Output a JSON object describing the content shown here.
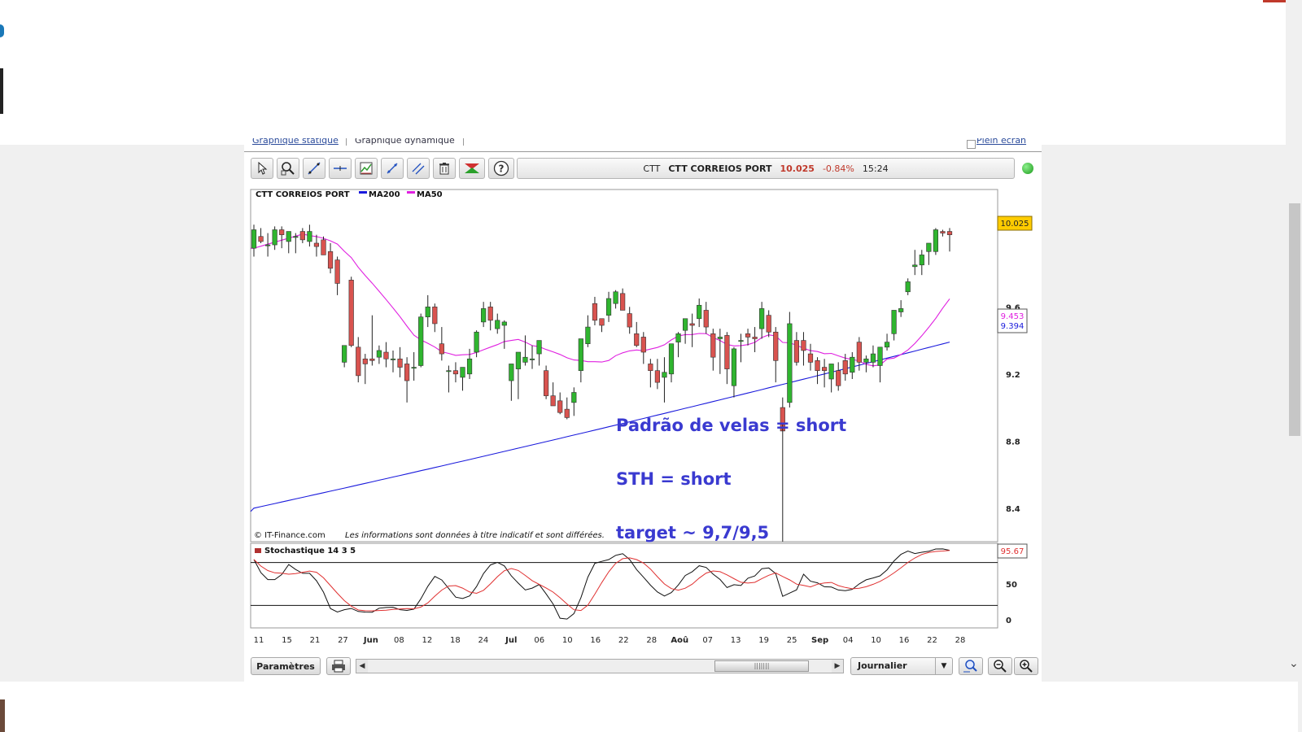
{
  "tabs": [
    "Graphique statique",
    "Graphique dynamique",
    "Plein écran"
  ],
  "toolbar": {
    "tools": [
      "cursor-icon",
      "zoom-area-icon",
      "trendline-icon",
      "horizontal-line-icon",
      "indicators-icon",
      "fibonacci-icon",
      "channel-icon",
      "trash-icon",
      "signal-icon",
      "help-icon"
    ]
  },
  "quote": {
    "ticker": "CTT",
    "name": "CTT CORREIOS PORT",
    "price": "10.025",
    "change": "-0.84%",
    "time": "15:24"
  },
  "colors": {
    "up": "#2fb52f",
    "down": "#d9534f",
    "ma200": "#1a1adc",
    "ma50": "#e020e0",
    "stoch_k": "#111111",
    "stoch_d": "#e03030",
    "annotation": "#3a3ad0"
  },
  "legend": {
    "series": "CTT CORREIOS PORT",
    "ma200": "MA200",
    "ma50": "MA50"
  },
  "copyright": "© IT-Finance.com",
  "disclaimer": "Les informations sont données à titre indicatif et sont différées.",
  "annotations": [
    "Padrão de velas = short",
    "STH = short",
    "target ~ 9,7/9,5"
  ],
  "price_labels": {
    "last": "10.025",
    "ma50": "9.453",
    "ma200": "9.394",
    "stoch_last": "95.67"
  },
  "stoch_legend": "Stochastique 14 3 5",
  "bottom": {
    "params": "Paramètres",
    "period": "Journalier"
  },
  "chart_data": {
    "type": "candlestick",
    "title": "CTT CORREIOS PORT",
    "y_ticks": [
      "9.6",
      "9.2",
      "8.8",
      "8.4"
    ],
    "ylim": [
      8.2,
      10.3
    ],
    "x_ticks": [
      "11",
      "15",
      "21",
      "27",
      "Jun",
      "08",
      "12",
      "18",
      "24",
      "Jul",
      "06",
      "10",
      "16",
      "22",
      "28",
      "Aoû",
      "07",
      "13",
      "19",
      "25",
      "Sep",
      "04",
      "10",
      "16",
      "22",
      "28"
    ],
    "candles": [
      {
        "o": 9.95,
        "h": 10.09,
        "l": 9.9,
        "c": 10.06
      },
      {
        "o": 10.02,
        "h": 10.07,
        "l": 9.98,
        "c": 9.99
      },
      {
        "o": 9.97,
        "h": 10.04,
        "l": 9.9,
        "c": 9.97
      },
      {
        "o": 9.97,
        "h": 10.08,
        "l": 9.94,
        "c": 10.06
      },
      {
        "o": 10.06,
        "h": 10.08,
        "l": 9.95,
        "c": 10.03
      },
      {
        "o": 9.99,
        "h": 10.05,
        "l": 9.92,
        "c": 10.05
      },
      {
        "o": 10.02,
        "h": 10.04,
        "l": 9.92,
        "c": 10.02
      },
      {
        "o": 10.05,
        "h": 10.07,
        "l": 9.98,
        "c": 10.0
      },
      {
        "o": 9.99,
        "h": 10.09,
        "l": 9.96,
        "c": 10.05
      },
      {
        "o": 9.98,
        "h": 10.03,
        "l": 9.9,
        "c": 9.96
      },
      {
        "o": 10.0,
        "h": 10.02,
        "l": 9.95,
        "c": 9.91
      },
      {
        "o": 9.93,
        "h": 9.98,
        "l": 9.8,
        "c": 9.83
      },
      {
        "o": 9.88,
        "h": 9.9,
        "l": 9.67,
        "c": 9.74
      },
      {
        "o": 9.27,
        "h": 9.37,
        "l": 9.24,
        "c": 9.37
      },
      {
        "o": 9.76,
        "h": 9.78,
        "l": 9.36,
        "c": 9.37
      },
      {
        "o": 9.36,
        "h": 9.42,
        "l": 9.15,
        "c": 9.19
      },
      {
        "o": 9.29,
        "h": 9.32,
        "l": 9.14,
        "c": 9.26
      },
      {
        "o": 9.29,
        "h": 9.55,
        "l": 9.25,
        "c": 9.28
      },
      {
        "o": 9.3,
        "h": 9.37,
        "l": 9.26,
        "c": 9.34
      },
      {
        "o": 9.33,
        "h": 9.39,
        "l": 9.24,
        "c": 9.29
      },
      {
        "o": 9.29,
        "h": 9.34,
        "l": 9.21,
        "c": 9.29
      },
      {
        "o": 9.29,
        "h": 9.36,
        "l": 9.18,
        "c": 9.24
      },
      {
        "o": 9.26,
        "h": 9.3,
        "l": 9.03,
        "c": 9.16
      },
      {
        "o": 9.24,
        "h": 9.33,
        "l": 9.16,
        "c": 9.24
      },
      {
        "o": 9.25,
        "h": 9.56,
        "l": 9.24,
        "c": 9.54
      },
      {
        "o": 9.54,
        "h": 9.67,
        "l": 9.48,
        "c": 9.6
      },
      {
        "o": 9.6,
        "h": 9.62,
        "l": 9.45,
        "c": 9.5
      },
      {
        "o": 9.38,
        "h": 9.48,
        "l": 9.28,
        "c": 9.32
      },
      {
        "o": 9.22,
        "h": 9.25,
        "l": 9.09,
        "c": 9.22
      },
      {
        "o": 9.22,
        "h": 9.27,
        "l": 9.15,
        "c": 9.2
      },
      {
        "o": 9.18,
        "h": 9.24,
        "l": 9.1,
        "c": 9.24
      },
      {
        "o": 9.2,
        "h": 9.35,
        "l": 9.17,
        "c": 9.29
      },
      {
        "o": 9.33,
        "h": 9.46,
        "l": 9.3,
        "c": 9.45
      },
      {
        "o": 9.51,
        "h": 9.63,
        "l": 9.48,
        "c": 9.59
      },
      {
        "o": 9.6,
        "h": 9.63,
        "l": 9.46,
        "c": 9.52
      },
      {
        "o": 9.47,
        "h": 9.56,
        "l": 9.44,
        "c": 9.52
      },
      {
        "o": 9.49,
        "h": 9.52,
        "l": 9.35,
        "c": 9.51
      },
      {
        "o": 9.16,
        "h": 9.23,
        "l": 9.04,
        "c": 9.26
      },
      {
        "o": 9.23,
        "h": 9.32,
        "l": 9.05,
        "c": 9.33
      },
      {
        "o": 9.27,
        "h": 9.43,
        "l": 9.25,
        "c": 9.3
      },
      {
        "o": 9.29,
        "h": 9.37,
        "l": 9.23,
        "c": 9.29
      },
      {
        "o": 9.32,
        "h": 9.4,
        "l": 9.25,
        "c": 9.4
      },
      {
        "o": 9.22,
        "h": 9.25,
        "l": 9.05,
        "c": 9.07
      },
      {
        "o": 9.07,
        "h": 9.15,
        "l": 9.01,
        "c": 9.01
      },
      {
        "o": 9.04,
        "h": 9.09,
        "l": 8.96,
        "c": 8.97
      },
      {
        "o": 8.99,
        "h": 9.06,
        "l": 8.93,
        "c": 8.94
      },
      {
        "o": 9.03,
        "h": 9.12,
        "l": 8.95,
        "c": 9.09
      },
      {
        "o": 9.22,
        "h": 9.28,
        "l": 9.15,
        "c": 9.41
      },
      {
        "o": 9.38,
        "h": 9.55,
        "l": 9.36,
        "c": 9.48
      },
      {
        "o": 9.62,
        "h": 9.66,
        "l": 9.49,
        "c": 9.52
      },
      {
        "o": 9.53,
        "h": 9.53,
        "l": 9.45,
        "c": 9.49
      },
      {
        "o": 9.55,
        "h": 9.69,
        "l": 9.51,
        "c": 9.65
      },
      {
        "o": 9.62,
        "h": 9.7,
        "l": 9.59,
        "c": 9.69
      },
      {
        "o": 9.68,
        "h": 9.71,
        "l": 9.58,
        "c": 9.58
      },
      {
        "o": 9.56,
        "h": 9.6,
        "l": 9.44,
        "c": 9.48
      },
      {
        "o": 9.44,
        "h": 9.51,
        "l": 9.36,
        "c": 9.37
      },
      {
        "o": 9.42,
        "h": 9.45,
        "l": 9.26,
        "c": 9.33
      },
      {
        "o": 9.26,
        "h": 9.29,
        "l": 9.12,
        "c": 9.22
      },
      {
        "o": 9.22,
        "h": 9.29,
        "l": 9.11,
        "c": 9.15
      },
      {
        "o": 9.18,
        "h": 9.3,
        "l": 9.03,
        "c": 9.21
      },
      {
        "o": 9.2,
        "h": 9.37,
        "l": 9.15,
        "c": 9.38
      },
      {
        "o": 9.39,
        "h": 9.45,
        "l": 9.3,
        "c": 9.44
      },
      {
        "o": 9.46,
        "h": 9.53,
        "l": 9.38,
        "c": 9.53
      },
      {
        "o": 9.5,
        "h": 9.56,
        "l": 9.36,
        "c": 9.49
      },
      {
        "o": 9.53,
        "h": 9.65,
        "l": 9.48,
        "c": 9.61
      },
      {
        "o": 9.58,
        "h": 9.63,
        "l": 9.44,
        "c": 9.48
      },
      {
        "o": 9.44,
        "h": 9.47,
        "l": 9.22,
        "c": 9.3
      },
      {
        "o": 9.41,
        "h": 9.47,
        "l": 9.2,
        "c": 9.42
      },
      {
        "o": 9.43,
        "h": 9.45,
        "l": 9.14,
        "c": 9.23
      },
      {
        "o": 9.13,
        "h": 9.36,
        "l": 9.06,
        "c": 9.35
      },
      {
        "o": 9.4,
        "h": 9.44,
        "l": 9.27,
        "c": 9.4
      },
      {
        "o": 9.44,
        "h": 9.47,
        "l": 9.37,
        "c": 9.42
      },
      {
        "o": 9.42,
        "h": 9.48,
        "l": 9.33,
        "c": 9.41
      },
      {
        "o": 9.47,
        "h": 9.63,
        "l": 9.41,
        "c": 9.59
      },
      {
        "o": 9.55,
        "h": 9.58,
        "l": 9.42,
        "c": 9.45
      },
      {
        "o": 9.45,
        "h": 9.48,
        "l": 9.15,
        "c": 9.28
      },
      {
        "o": 9.0,
        "h": 9.06,
        "l": 8.9,
        "c": 8.86
      },
      {
        "o": 9.03,
        "h": 9.57,
        "l": 9.0,
        "c": 9.5
      },
      {
        "o": 9.4,
        "h": 9.45,
        "l": 9.25,
        "c": 9.27
      },
      {
        "o": 9.4,
        "h": 9.45,
        "l": 9.25,
        "c": 9.34
      },
      {
        "o": 9.32,
        "h": 9.38,
        "l": 9.22,
        "c": 9.27
      },
      {
        "o": 9.28,
        "h": 9.3,
        "l": 9.14,
        "c": 9.22
      },
      {
        "o": 9.24,
        "h": 9.29,
        "l": 9.12,
        "c": 9.22
      },
      {
        "o": 9.17,
        "h": 9.22,
        "l": 9.09,
        "c": 9.26
      },
      {
        "o": 9.22,
        "h": 9.27,
        "l": 9.1,
        "c": 9.13
      },
      {
        "o": 9.28,
        "h": 9.32,
        "l": 9.16,
        "c": 9.2
      },
      {
        "o": 9.21,
        "h": 9.33,
        "l": 9.17,
        "c": 9.3
      },
      {
        "o": 9.39,
        "h": 9.42,
        "l": 9.22,
        "c": 9.27
      },
      {
        "o": 9.27,
        "h": 9.31,
        "l": 9.21,
        "c": 9.29
      },
      {
        "o": 9.27,
        "h": 9.37,
        "l": 9.24,
        "c": 9.32
      },
      {
        "o": 9.25,
        "h": 9.34,
        "l": 9.15,
        "c": 9.36
      },
      {
        "o": 9.36,
        "h": 9.44,
        "l": 9.34,
        "c": 9.39
      },
      {
        "o": 9.44,
        "h": 9.58,
        "l": 9.4,
        "c": 9.58
      },
      {
        "o": 9.57,
        "h": 9.64,
        "l": 9.54,
        "c": 9.59
      },
      {
        "o": 9.69,
        "h": 9.77,
        "l": 9.67,
        "c": 9.75
      },
      {
        "o": 9.84,
        "h": 9.94,
        "l": 9.79,
        "c": 9.85
      },
      {
        "o": 9.85,
        "h": 9.94,
        "l": 9.79,
        "c": 9.91
      },
      {
        "o": 9.93,
        "h": 9.97,
        "l": 9.85,
        "c": 9.98
      },
      {
        "o": 9.93,
        "h": 10.07,
        "l": 9.91,
        "c": 10.06
      },
      {
        "o": 10.05,
        "h": 10.06,
        "l": 10.02,
        "c": 10.04
      },
      {
        "o": 10.05,
        "h": 10.07,
        "l": 9.93,
        "c": 10.03
      }
    ],
    "ma200_start": 8.4,
    "ma200_end": 9.39,
    "stoch_y_ticks": [
      "50",
      "0"
    ],
    "stoch_ylim": [
      0,
      100
    ],
    "stoch_levels": [
      80,
      20
    ]
  }
}
